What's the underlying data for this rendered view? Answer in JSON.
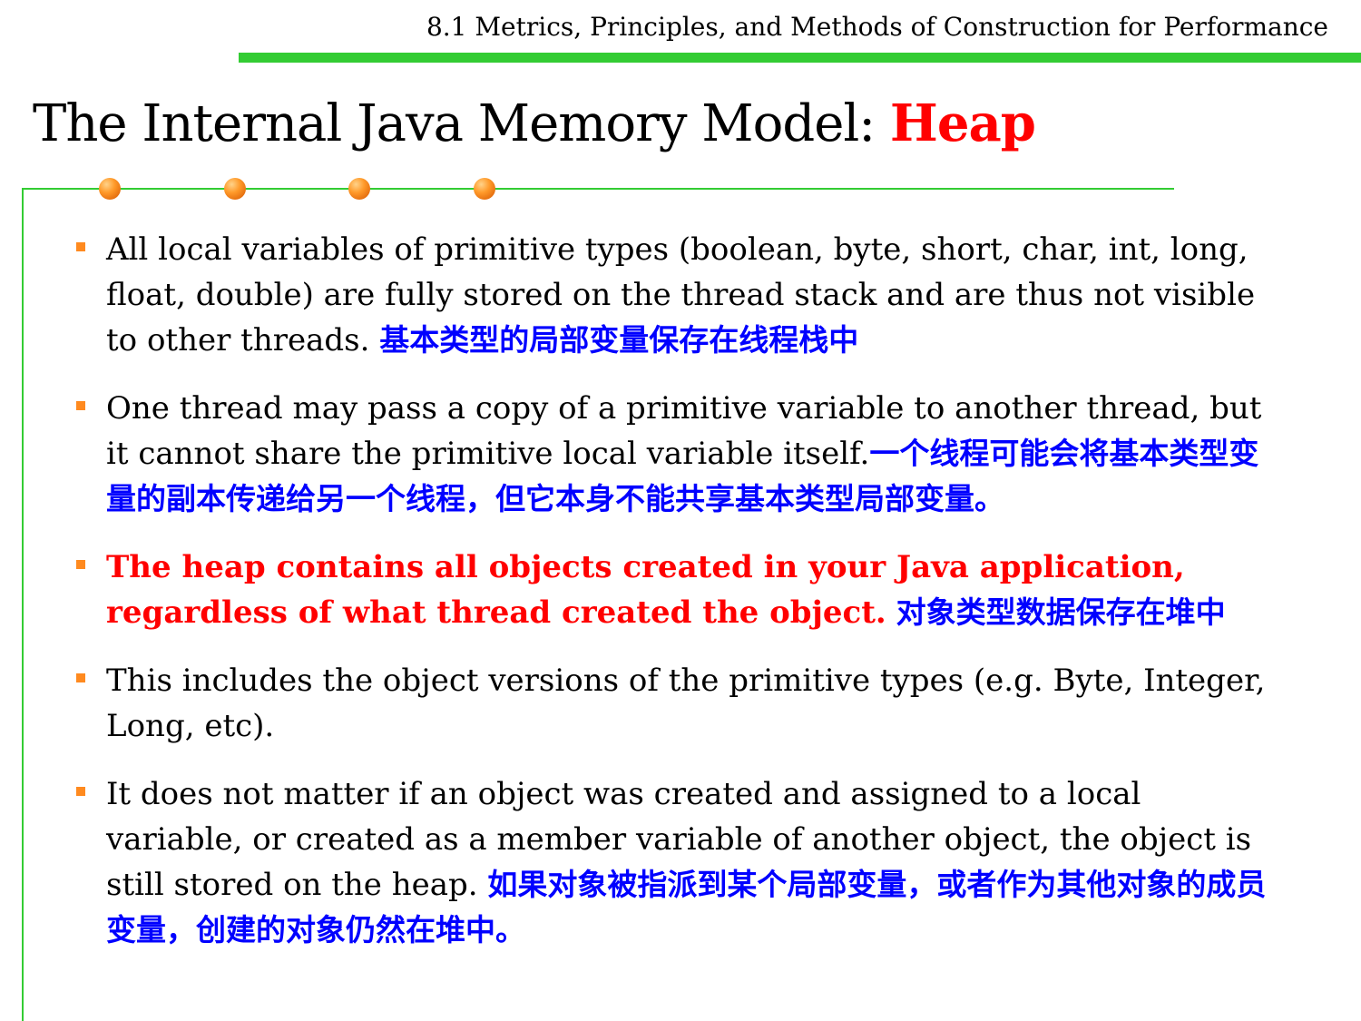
{
  "header": {
    "section_title": "8.1 Metrics, Principles, and Methods of Construction for Performance"
  },
  "title": {
    "prefix": "The Internal Java Memory Model: ",
    "highlight": "Heap"
  },
  "bullets": [
    {
      "text": "All local variables of primitive types (boolean, byte, short, char, int, long, float, double) are fully stored on the thread stack and are thus not visible to other threads.",
      "note": "基本类型的局部变量保存在线程栈中"
    },
    {
      "text": "One thread may pass a copy of a primitive variable to another thread, but it cannot share the primitive local variable itself.",
      "note": "一个线程可能会将基本类型变量的副本传递给另一个线程，但它本身不能共享基本类型局部变量。"
    },
    {
      "text": "The heap contains all objects created in your Java application, regardless of what thread created the object.",
      "note": "对象类型数据保存在堆中"
    },
    {
      "text": "This includes the object versions of the primitive types (e.g. Byte, Integer, Long, etc).",
      "note": ""
    },
    {
      "text": "It does not matter if an object was created and assigned to a local variable, or created as a member variable of another object, the object is still stored on the heap.",
      "note": "如果对象被指派到某个局部变量，或者作为其他对象的成员变量，创建的对象仍然在堆中。"
    }
  ],
  "colors": {
    "accent_green": "#33cc33",
    "highlight_red": "#ff0000",
    "chinese_blue": "#0000ff",
    "bullet_orange": "#ff8a1f"
  }
}
